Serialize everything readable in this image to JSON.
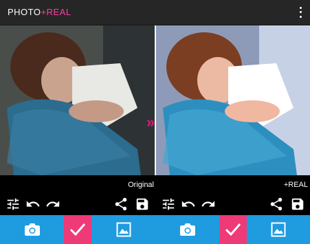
{
  "app": {
    "title_left": "PHOTO",
    "title_right": "+REAL"
  },
  "left_panel": {
    "label": "Original"
  },
  "right_panel": {
    "label": "+REAL"
  },
  "icons": {
    "menu": "more-vert-icon",
    "adjust": "tune-icon",
    "undo": "undo-icon",
    "redo": "redo-icon",
    "share": "share-icon",
    "save": "save-icon",
    "camera": "camera-icon",
    "apply": "check-icon",
    "gallery": "image-icon",
    "compare": "double-chevron-right-icon"
  },
  "colors": {
    "appbar": "#262626",
    "accent_pink": "#ee3a77",
    "accent_blue": "#1f9be0",
    "logo_plus": "#ff3fa4"
  }
}
